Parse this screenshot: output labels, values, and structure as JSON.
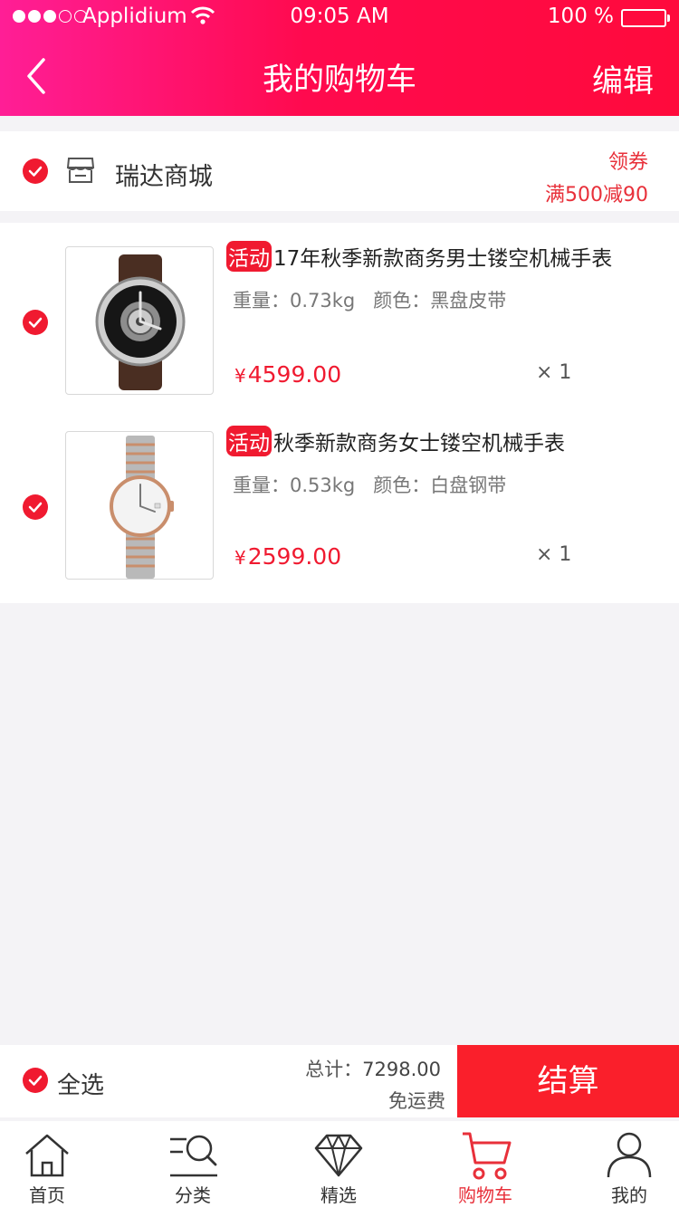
{
  "status_bar": {
    "carrier": "Applidium",
    "time": "09:05 AM",
    "battery": "100 %"
  },
  "header": {
    "title": "我的购物车",
    "edit_label": "编辑"
  },
  "store": {
    "name": "瑞达商城",
    "coupon_label": "领券",
    "promo_label": "满500减90",
    "checked": true
  },
  "items": [
    {
      "tag": "活动",
      "title": "17年秋季新款商务男士镂空机械手表",
      "weight": "重量：0.73kg",
      "color": "颜色：黑盘皮带",
      "currency": "¥",
      "price": "4599.00",
      "qty": "× 1",
      "checked": true
    },
    {
      "tag": "活动",
      "title": "秋季新款商务女士镂空机械手表",
      "weight": "重量：0.53kg",
      "color": "颜色：白盘钢带",
      "currency": "¥",
      "price": "2599.00",
      "qty": "× 1",
      "checked": true
    }
  ],
  "summary": {
    "select_all_label": "全选",
    "total_label": "总计：",
    "total_value": "7298.00",
    "shipping_label": "免运费",
    "checkout_label": "结算"
  },
  "tabs": [
    {
      "label": "首页",
      "icon": "home-icon"
    },
    {
      "label": "分类",
      "icon": "category-search-icon"
    },
    {
      "label": "精选",
      "icon": "diamond-icon"
    },
    {
      "label": "购物车",
      "icon": "cart-icon",
      "active": true
    },
    {
      "label": "我的",
      "icon": "user-icon"
    }
  ],
  "colors": {
    "accent": "#f01a30",
    "header_start": "#ff1e96",
    "header_end": "#ff0a3c",
    "checkout": "#fa1f2b"
  }
}
